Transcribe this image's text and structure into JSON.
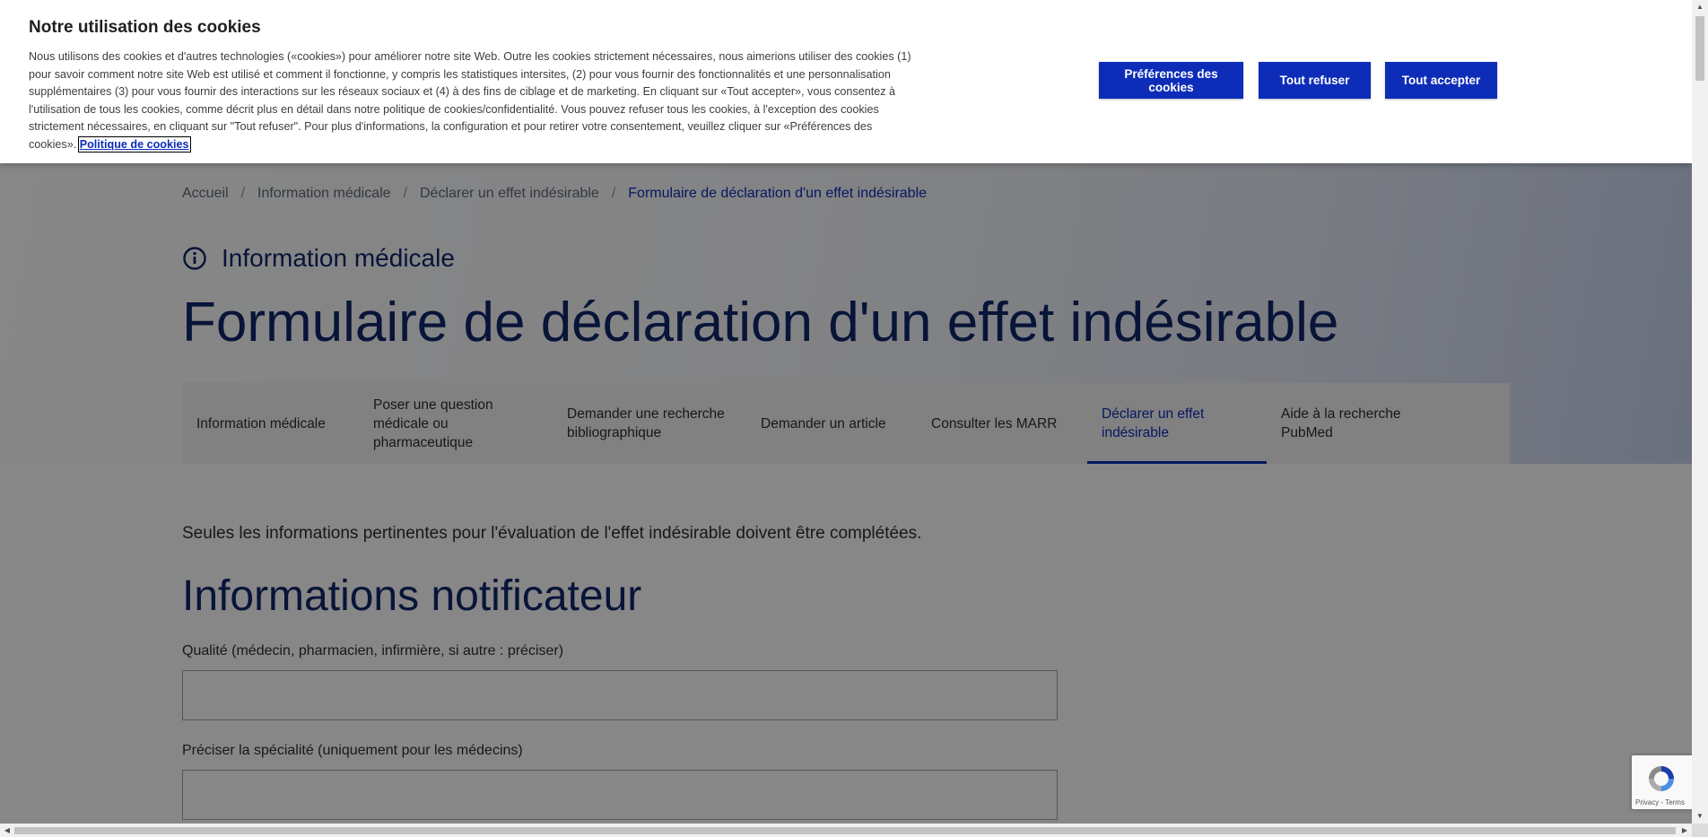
{
  "cookie_banner": {
    "title": "Notre utilisation des cookies",
    "text": "Nous utilisons des cookies et d'autres technologies («cookies») pour améliorer notre site Web. Outre les cookies strictement nécessaires, nous aimerions utiliser des cookies (1) pour savoir comment notre site Web est utilisé et comment il fonctionne, y compris les statistiques intersites, (2) pour vous fournir des fonctionnalités et une personnalisation supplémentaires (3) pour vous fournir des interactions sur les réseaux sociaux et (4) à des fins de ciblage et de marketing. En cliquant sur «Tout accepter», vous consentez à l'utilisation de tous les cookies, comme décrit plus en détail dans notre politique de cookies/confidentialité. Vous pouvez refuser tous les cookies, à l'exception des cookies strictement nécessaires, en cliquant sur \"Tout refuser\". Pour plus d'informations, la configuration et pour retirer votre consentement, veuillez cliquer sur «Préférences des cookies».",
    "policy_link": "Politique de cookies",
    "preferences_button": "Préférences des cookies",
    "refuse_button": "Tout refuser",
    "accept_button": "Tout accepter"
  },
  "breadcrumb": {
    "items": [
      "Accueil",
      "Information médicale",
      "Déclarer un effet indésirable"
    ],
    "current": "Formulaire de déclaration d'un effet indésirable",
    "separator": "/"
  },
  "section": {
    "label": "Information médicale",
    "icon": "info-circle-icon"
  },
  "page_title": "Formulaire de déclaration d'un effet indésirable",
  "tabs": [
    {
      "label": "Information médicale"
    },
    {
      "label": "Poser une question médicale ou pharmaceutique"
    },
    {
      "label": "Demander une recherche bibliographique"
    },
    {
      "label": "Demander un article"
    },
    {
      "label": "Consulter les MARR"
    },
    {
      "label": "Déclarer un effet indésirable",
      "active": true
    },
    {
      "label": "Aide à la recherche PubMed"
    }
  ],
  "intro": "Seules les informations pertinentes pour l'évaluation de l'effet indésirable doivent être complétées.",
  "form": {
    "heading": "Informations notificateur",
    "fields": [
      {
        "label": "Qualité (médecin, pharmacien, infirmière, si autre : préciser)",
        "value": ""
      },
      {
        "label": "Préciser la spécialité (uniquement pour les médecins)",
        "value": ""
      }
    ]
  },
  "recaptcha": {
    "text": "Privacy - Terms"
  },
  "colors": {
    "accent": "#0d2db8",
    "title": "#10266b"
  }
}
